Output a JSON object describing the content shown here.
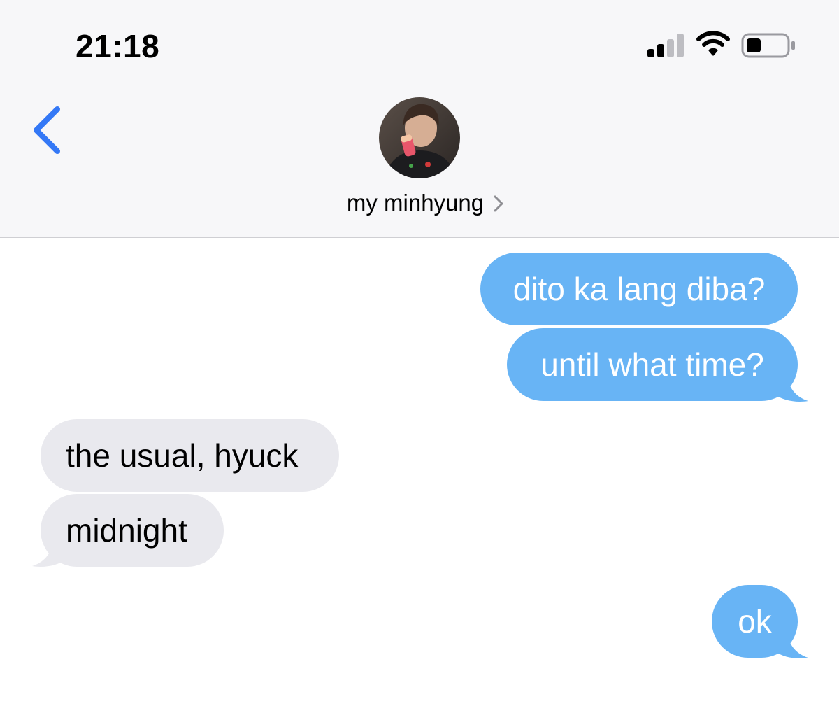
{
  "status_bar": {
    "time": "21:18",
    "icons": [
      "signal-icon",
      "wifi-icon",
      "battery-icon"
    ]
  },
  "nav": {
    "back_icon": "chevron-left-icon",
    "contact_name": "my minhyung",
    "detail_icon": "chevron-right-icon"
  },
  "messages": [
    {
      "sender": "me",
      "text": "dito ka lang diba?"
    },
    {
      "sender": "me",
      "text": "until what time?"
    },
    {
      "sender": "them",
      "text": "the usual, hyuck"
    },
    {
      "sender": "them",
      "text": "midnight"
    },
    {
      "sender": "me",
      "text": "ok"
    }
  ],
  "colors": {
    "sent_bubble": "#68b4f5",
    "received_bubble": "#e9e9ee",
    "accent": "#3478f6",
    "header_bg": "#f7f7f9"
  }
}
